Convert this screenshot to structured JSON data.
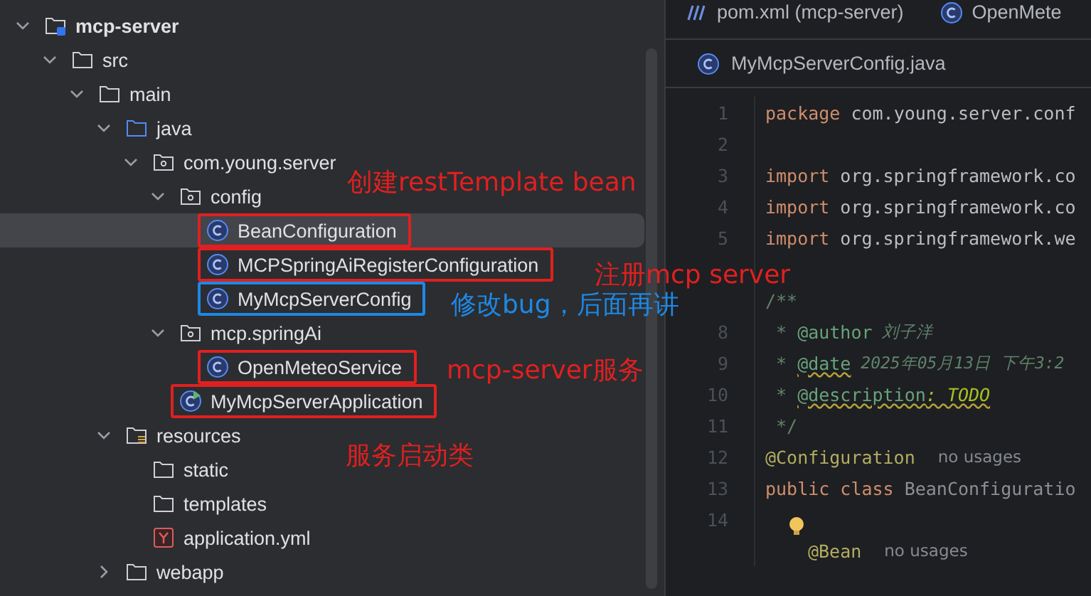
{
  "project_tree": [
    {
      "label": "mcp-server",
      "kind": "module",
      "expanded": true,
      "selected": false,
      "children": [
        {
          "label": "src",
          "kind": "folder",
          "expanded": true,
          "selected": false,
          "children": [
            {
              "label": "main",
              "kind": "folder",
              "expanded": true,
              "selected": false,
              "children": [
                {
                  "label": "java",
                  "kind": "source-folder",
                  "expanded": true,
                  "selected": false,
                  "children": [
                    {
                      "label": "com.young.server",
                      "kind": "package",
                      "expanded": true,
                      "selected": false,
                      "children": [
                        {
                          "label": "config",
                          "kind": "package",
                          "expanded": true,
                          "selected": false,
                          "children": [
                            {
                              "label": "BeanConfiguration",
                              "kind": "class",
                              "selected": true,
                              "color": "#e02020"
                            },
                            {
                              "label": "MCPSpringAiRegisterConfiguration",
                              "kind": "class",
                              "selected": false,
                              "color": "#e02020"
                            },
                            {
                              "label": "MyMcpServerConfig",
                              "kind": "class",
                              "selected": false,
                              "color": "#1e88e5"
                            }
                          ]
                        },
                        {
                          "label": "mcp.springAi",
                          "kind": "package",
                          "expanded": true,
                          "selected": false,
                          "children": [
                            {
                              "label": "OpenMeteoService",
                              "kind": "class",
                              "selected": false,
                              "color": "#e02020"
                            }
                          ]
                        },
                        {
                          "label": "MyMcpServerApplication",
                          "kind": "app-class",
                          "selected": false,
                          "color": "#e02020"
                        }
                      ]
                    }
                  ]
                },
                {
                  "label": "resources",
                  "kind": "resources-folder",
                  "expanded": true,
                  "selected": false,
                  "children": [
                    {
                      "label": "static",
                      "kind": "folder",
                      "selected": false
                    },
                    {
                      "label": "templates",
                      "kind": "folder",
                      "selected": false
                    },
                    {
                      "label": "application.yml",
                      "kind": "yaml",
                      "selected": false
                    }
                  ]
                },
                {
                  "label": "webapp",
                  "kind": "folder",
                  "expanded": false,
                  "selected": false
                }
              ]
            }
          ]
        }
      ]
    }
  ],
  "editor_tabs": [
    {
      "label": "pom.xml (mcp-server)",
      "kind": "maven",
      "selected": false
    },
    {
      "label": "OpenMete",
      "kind": "class",
      "selected": false
    }
  ],
  "file_tab": {
    "label": "MyMcpServerConfig.java"
  },
  "code_lines": [
    {
      "kind": "code",
      "number": "1",
      "tokens": [
        {
          "kind": "keyword",
          "text": "package"
        },
        {
          "kind": "plain",
          "text": " com.young.server.conf"
        }
      ]
    },
    {
      "kind": "code",
      "number": "2"
    },
    {
      "kind": "code",
      "number": "3",
      "tokens": [
        {
          "kind": "keyword",
          "text": "import"
        },
        {
          "kind": "plain",
          "text": " org.springframework.co"
        }
      ]
    },
    {
      "kind": "code",
      "number": "4",
      "tokens": [
        {
          "kind": "keyword",
          "text": "import"
        },
        {
          "kind": "plain",
          "text": " org.springframework.co"
        }
      ]
    },
    {
      "kind": "code",
      "number": "5",
      "tokens": [
        {
          "kind": "keyword",
          "text": "import"
        },
        {
          "kind": "plain",
          "text": " org.springframework.we"
        }
      ]
    },
    {
      "kind": "blank"
    },
    {
      "kind": "code",
      "tokens": [
        {
          "kind": "comment",
          "text": "/**"
        }
      ]
    },
    {
      "kind": "code",
      "number": "8",
      "tokens": [
        {
          "kind": "comment",
          "text": " * "
        },
        {
          "kind": "doctag",
          "text": "@author"
        },
        {
          "kind": "comment-italic",
          "text": " 刘子洋"
        }
      ]
    },
    {
      "kind": "code",
      "number": "9",
      "tokens": [
        {
          "kind": "comment",
          "text": " * "
        },
        {
          "kind": "doctag-warn",
          "text": "@date"
        },
        {
          "kind": "comment-italic",
          "text": " 2025年05月13日 下午3:2"
        }
      ]
    },
    {
      "kind": "code",
      "number": "10",
      "tokens": [
        {
          "kind": "comment",
          "text": " * "
        },
        {
          "kind": "doctag-warn",
          "text": "@description"
        },
        {
          "kind": "todo",
          "text": ": TODO"
        }
      ]
    },
    {
      "kind": "code",
      "number": "11",
      "tokens": [
        {
          "kind": "comment",
          "text": " */"
        }
      ]
    },
    {
      "kind": "code",
      "number": "12",
      "tokens": [
        {
          "kind": "annotation",
          "text": "@Configuration"
        },
        {
          "kind": "hint",
          "text": "no usages"
        }
      ]
    },
    {
      "kind": "code",
      "number": "13",
      "tokens": [
        {
          "kind": "keyword",
          "text": "public class"
        },
        {
          "kind": "unused",
          "text": " BeanConfiguratio"
        }
      ]
    },
    {
      "kind": "code",
      "number": "14"
    },
    {
      "kind": "indented",
      "tokens": [
        {
          "kind": "annotation",
          "text": "@Bean"
        },
        {
          "kind": "hint",
          "text": "no usages"
        }
      ]
    }
  ],
  "annotations": [
    {
      "text": "创建restTemplate bean",
      "color": "#e02020"
    },
    {
      "text": "注册mcp server",
      "color": "#e02020"
    },
    {
      "text": "修改bug，后面再讲",
      "color": "#1e88e5"
    },
    {
      "text": "mcp-server服务",
      "color": "#e02020"
    },
    {
      "text": "服务启动类",
      "color": "#e02020"
    }
  ]
}
